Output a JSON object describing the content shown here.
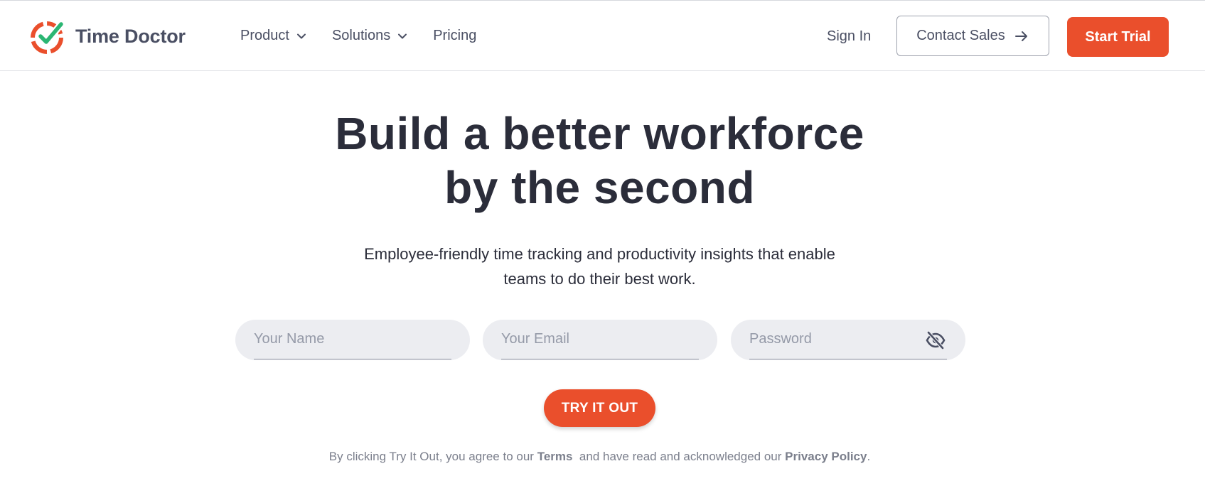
{
  "brand": {
    "name": "Time Doctor",
    "logo_icon": "time-doctor-logo-icon",
    "accent_color": "#ea4f2c",
    "check_color": "#2bb673"
  },
  "nav": {
    "items": [
      {
        "label": "Product",
        "has_dropdown": true
      },
      {
        "label": "Solutions",
        "has_dropdown": true
      },
      {
        "label": "Pricing",
        "has_dropdown": false
      }
    ],
    "sign_in": "Sign In",
    "contact_sales": "Contact Sales",
    "start_trial": "Start Trial"
  },
  "hero": {
    "title_line1": "Build a better workforce",
    "title_line2": "by the second",
    "subtitle_line1": "Employee-friendly time tracking and productivity insights that enable",
    "subtitle_line2": "teams to do their best work."
  },
  "form": {
    "name_placeholder": "Your Name",
    "name_value": "",
    "email_placeholder": "Your Email",
    "email_value": "",
    "password_placeholder": "Password",
    "password_value": "",
    "password_toggle_icon": "eye-off-icon",
    "submit_label": "TRY IT OUT"
  },
  "legal": {
    "prefix": "By clicking Try It Out, you agree to our",
    "terms": "Terms",
    "middle": "and have read and acknowledged our",
    "privacy": "Privacy Policy",
    "suffix": "."
  }
}
